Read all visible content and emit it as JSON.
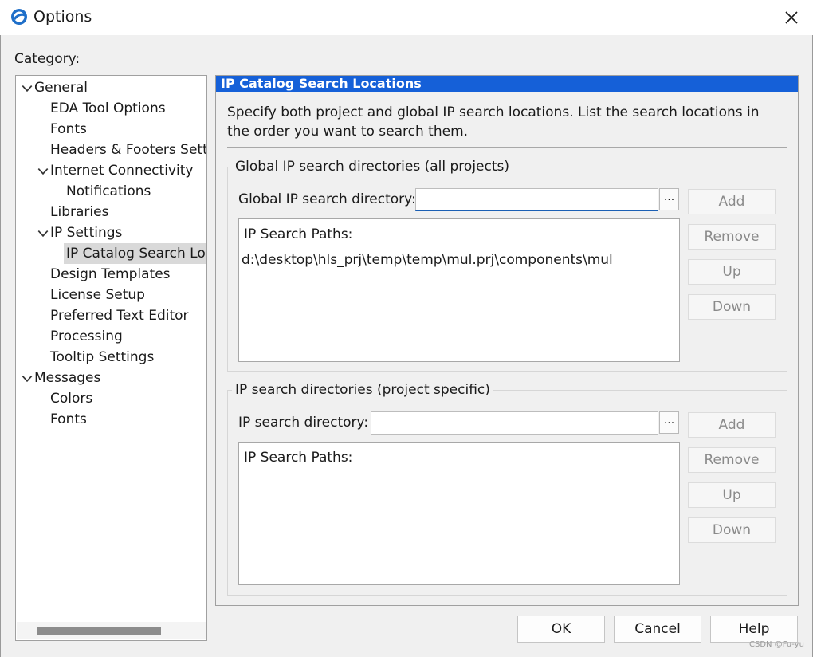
{
  "window": {
    "title": "Options",
    "close_glyph": "✕"
  },
  "category_label": "Category:",
  "tree": [
    {
      "label": "General",
      "level": 0,
      "expandable": true,
      "expanded": true
    },
    {
      "label": "EDA Tool Options",
      "level": 1
    },
    {
      "label": "Fonts",
      "level": 1
    },
    {
      "label": "Headers & Footers Settings",
      "level": 1
    },
    {
      "label": "Internet Connectivity",
      "level": 1,
      "expandable": true,
      "expanded": true
    },
    {
      "label": "Notifications",
      "level": 2
    },
    {
      "label": "Libraries",
      "level": 1
    },
    {
      "label": "IP Settings",
      "level": 1,
      "expandable": true,
      "expanded": true
    },
    {
      "label": "IP Catalog Search Locations",
      "level": 2,
      "selected": true
    },
    {
      "label": "Design Templates",
      "level": 1
    },
    {
      "label": "License Setup",
      "level": 1
    },
    {
      "label": "Preferred Text Editor",
      "level": 1
    },
    {
      "label": "Processing",
      "level": 1
    },
    {
      "label": "Tooltip Settings",
      "level": 1
    },
    {
      "label": "Messages",
      "level": 0,
      "expandable": true,
      "expanded": true
    },
    {
      "label": "Colors",
      "level": 1
    },
    {
      "label": "Fonts",
      "level": 1
    }
  ],
  "panel": {
    "header": "IP Catalog Search Locations",
    "description": "Specify both project and global IP search locations. List the search locations in the order you want to search them.",
    "global": {
      "group_title": "Global IP search directories (all projects)",
      "field_label": "Global IP search directory:",
      "field_value": "",
      "browse_label": "...",
      "list_header": "IP Search Paths:",
      "paths": [
        "d:\\desktop\\hls_prj\\temp\\temp\\mul.prj\\components\\mul"
      ],
      "buttons": {
        "add": "Add",
        "remove": "Remove",
        "up": "Up",
        "down": "Down"
      }
    },
    "project": {
      "group_title": "IP search directories (project specific)",
      "field_label": "IP search directory:",
      "field_value": "",
      "browse_label": "...",
      "list_header": "IP Search Paths:",
      "paths": [],
      "buttons": {
        "add": "Add",
        "remove": "Remove",
        "up": "Up",
        "down": "Down"
      }
    }
  },
  "footer": {
    "ok": "OK",
    "cancel": "Cancel",
    "help": "Help"
  },
  "watermark": "CSDN @Fu-yu",
  "colors": {
    "header_bg": "#1560d8",
    "selection_bg": "#d9d9d9",
    "focus_underline": "#1b5fb4"
  }
}
